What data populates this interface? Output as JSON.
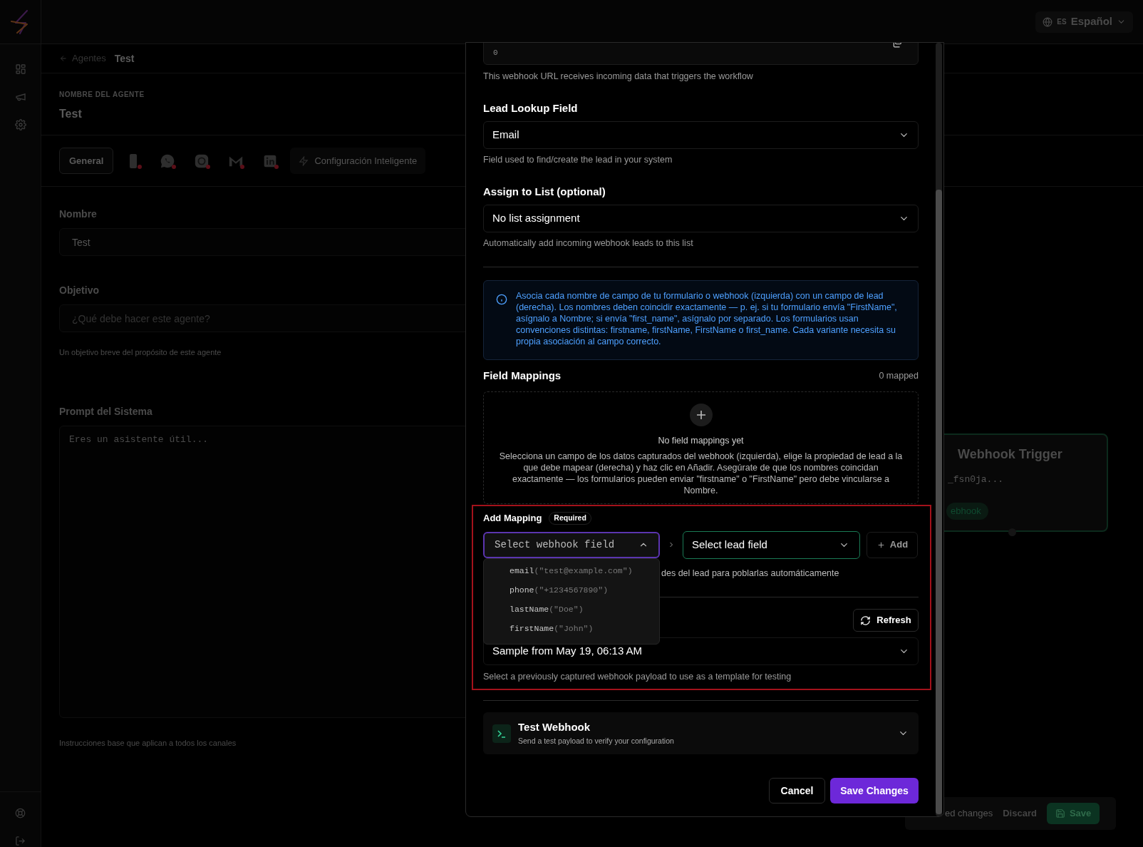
{
  "language": {
    "code": "ES",
    "label": "Español"
  },
  "breadcrumb": {
    "back": "Agentes",
    "current": "Test"
  },
  "agent": {
    "label": "NOMBRE DEL AGENTE",
    "name": "Test"
  },
  "tabs": [
    {
      "kind": "text",
      "label": "General",
      "selected": true
    },
    {
      "kind": "channel",
      "connected": false,
      "selected": false
    },
    {
      "kind": "channel",
      "connected": false,
      "selected": false
    },
    {
      "kind": "channel",
      "connected": false,
      "selected": false
    },
    {
      "kind": "channel",
      "connected": false,
      "selected": false
    },
    {
      "kind": "channel",
      "connected": false,
      "selected": false
    },
    {
      "kind": "smart",
      "label": "Configuración Inteligente",
      "selected": false
    }
  ],
  "form": [
    {
      "kind": "input",
      "label": "Nombre",
      "value": "Test"
    },
    {
      "kind": "input",
      "label": "Objetivo",
      "placeholder": "¿Qué debe hacer este agente?",
      "hint": "Un objetivo breve del propósito de este agente"
    },
    {
      "kind": "textarea",
      "label": "Prompt del Sistema",
      "placeholder": "Eres un asistente útil...",
      "hint": "Instrucciones base que aplican a todos los canales"
    }
  ],
  "canvas": {
    "node": {
      "title": "Webhook Trigger",
      "subtitle": "_fsn0ja...",
      "tag": "ebhook"
    },
    "footer": {
      "status": "ed changes",
      "discard": "Discard",
      "save": "Save"
    }
  },
  "modal": {
    "url_field": {
      "value": "0",
      "hint": "This webhook URL receives incoming data that triggers the workflow"
    },
    "lookup": {
      "label": "Lead Lookup Field",
      "value": "Email",
      "hint": "Field used to find/create the lead in your system"
    },
    "list": {
      "label": "Assign to List (optional)",
      "value": "No list assignment",
      "hint": "Automatically add incoming webhook leads to this list"
    },
    "info": "Asocia cada nombre de campo de tu formulario o webhook (izquierda) con un campo de lead (derecha). Los nombres deben coincidir exactamente — p. ej. si tu formulario envía \"FirstName\", asígnalo a Nombre; si envía \"first_name\", asígnalo por separado. Los formularios usan convenciones distintas: firstname, firstName, FirstName o first_name. Cada variante necesita su propia asociación al campo correcto.",
    "mappings": {
      "title": "Field Mappings",
      "count": "0 mapped",
      "empty_title": "No field mappings yet",
      "empty_text": "Selecciona un campo de los datos capturados del webhook (izquierda), elige la propiedad de lead a la que debe mapear (derecha) y haz clic en Añadir. Asegúrate de que los nombres coincidan exactamente — los formularios pueden enviar \"firstname\" o \"FirstName\" pero debe vincularse a Nombre."
    },
    "add_mapping": {
      "title": "Add Mapping",
      "badge": "Required",
      "webhook_field": {
        "placeholder": "Select webhook field",
        "expanded": true
      },
      "lead_field": {
        "placeholder": "Select lead field"
      },
      "add_button": "Add",
      "hint": "des del lead para poblarlas automáticamente",
      "options": [
        {
          "key": "email",
          "sample": "(\"test@example.com\")"
        },
        {
          "key": "phone",
          "sample": "(\"+1234567890\")"
        },
        {
          "key": "lastName",
          "sample": "(\"Doe\")"
        },
        {
          "key": "firstName",
          "sample": "(\"John\")"
        }
      ]
    },
    "sample": {
      "refresh_button": "Refresh",
      "value": "Sample from May 19, 06:13 AM",
      "hint": "Select a previously captured webhook payload to use as a template for testing"
    },
    "test": {
      "title": "Test Webhook",
      "subtitle": "Send a test payload to verify your configuration",
      "expanded": false
    },
    "buttons": {
      "cancel": "Cancel",
      "save": "Save Changes"
    }
  }
}
